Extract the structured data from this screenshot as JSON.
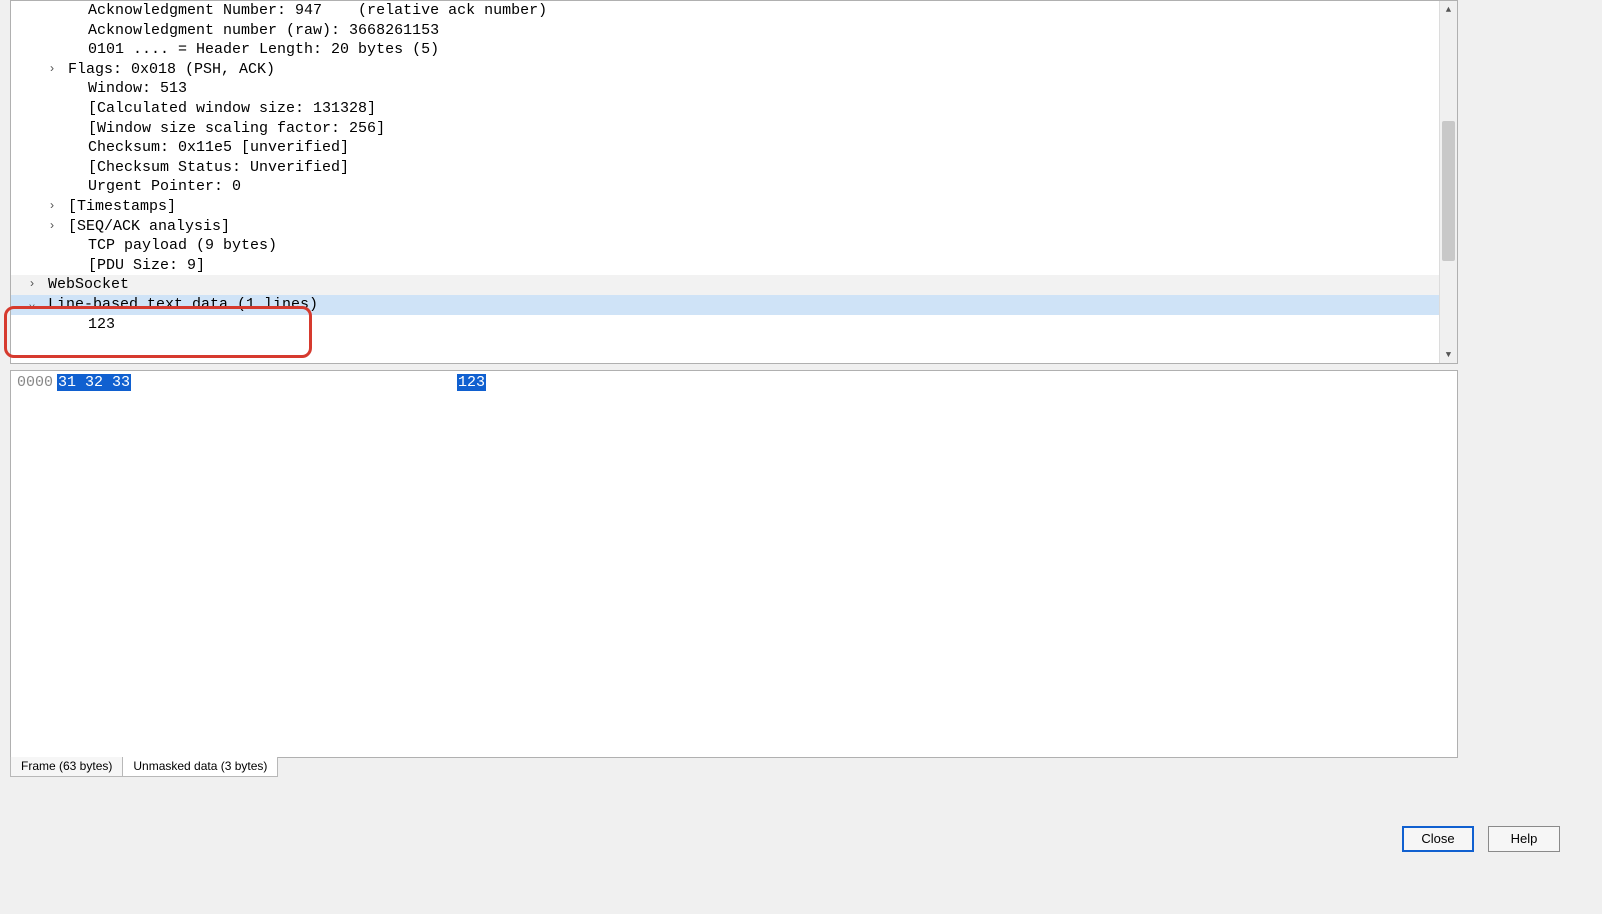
{
  "tree": {
    "rows": [
      {
        "indent": 3,
        "tog": "",
        "text": "Acknowledgment Number: 947    (relative ack number)"
      },
      {
        "indent": 3,
        "tog": "",
        "text": "Acknowledgment number (raw): 3668261153"
      },
      {
        "indent": 3,
        "tog": "",
        "text": "0101 .... = Header Length: 20 bytes (5)"
      },
      {
        "indent": 2,
        "tog": ">",
        "text": "Flags: 0x018 (PSH, ACK)"
      },
      {
        "indent": 3,
        "tog": "",
        "text": "Window: 513"
      },
      {
        "indent": 3,
        "tog": "",
        "text": "[Calculated window size: 131328]"
      },
      {
        "indent": 3,
        "tog": "",
        "text": "[Window size scaling factor: 256]"
      },
      {
        "indent": 3,
        "tog": "",
        "text": "Checksum: 0x11e5 [unverified]"
      },
      {
        "indent": 3,
        "tog": "",
        "text": "[Checksum Status: Unverified]"
      },
      {
        "indent": 3,
        "tog": "",
        "text": "Urgent Pointer: 0"
      },
      {
        "indent": 2,
        "tog": ">",
        "text": "[Timestamps]"
      },
      {
        "indent": 2,
        "tog": ">",
        "text": "[SEQ/ACK analysis]"
      },
      {
        "indent": 3,
        "tog": "",
        "text": "TCP payload (9 bytes)"
      },
      {
        "indent": 3,
        "tog": "",
        "text": "[PDU Size: 9]"
      },
      {
        "indent": 1,
        "tog": ">",
        "text": "WebSocket",
        "cls": "ws"
      },
      {
        "indent": 1,
        "tog": "v",
        "text": "Line-based text data (1 lines)",
        "cls": "sel"
      },
      {
        "indent": 3,
        "tog": "",
        "text": "123"
      }
    ]
  },
  "hex": {
    "offset": "0000",
    "bytes": "31 32 33",
    "ascii": "123"
  },
  "tabs": {
    "frame": "Frame (63 bytes)",
    "unmasked": "Unmasked data (3 bytes)"
  },
  "buttons": {
    "close": "Close",
    "help": "Help"
  }
}
